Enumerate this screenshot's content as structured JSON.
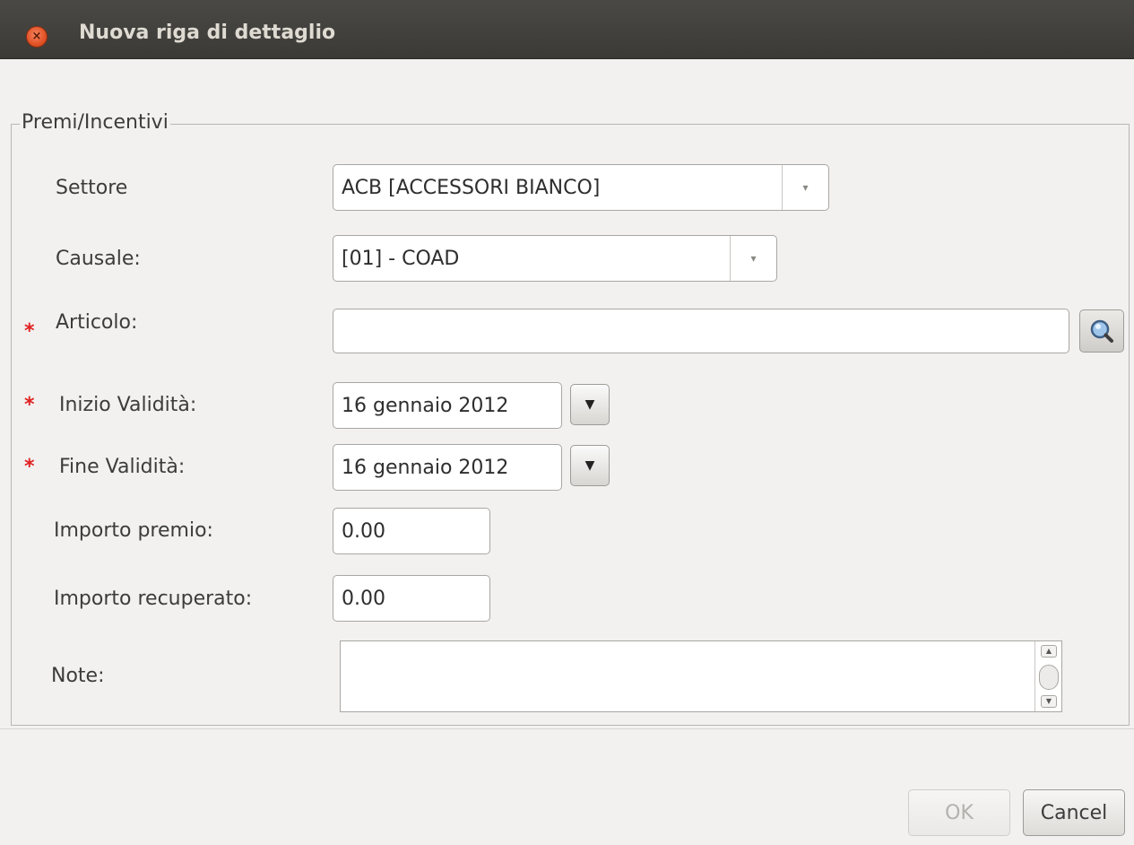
{
  "window": {
    "title": "Nuova riga di dettaglio",
    "close_glyph": "×"
  },
  "group": {
    "title": "Premi/Incentivi"
  },
  "fields": {
    "settore": {
      "label": "Settore",
      "value": "ACB  [ACCESSORI BIANCO]"
    },
    "causale": {
      "label": "Causale:",
      "value": "[01] - COAD"
    },
    "articolo": {
      "label": "Articolo:",
      "value": "",
      "required": true
    },
    "inizio": {
      "label": "Inizio Validità:",
      "value": "16 gennaio 2012",
      "required": true
    },
    "fine": {
      "label": "Fine Validità:",
      "value": "16 gennaio 2012",
      "required": true
    },
    "importo_premio": {
      "label": "Importo premio:",
      "value": "0.00"
    },
    "importo_recuperato": {
      "label": "Importo recuperato:",
      "value": "0.00"
    },
    "note": {
      "label": "Note:",
      "value": ""
    }
  },
  "required_marker": "*",
  "icons": {
    "combo": "▾",
    "date": "▼",
    "scroll_up": "▲",
    "scroll_down": "▼",
    "search": "magnifier-icon"
  },
  "buttons": {
    "ok": "OK",
    "cancel": "Cancel"
  }
}
